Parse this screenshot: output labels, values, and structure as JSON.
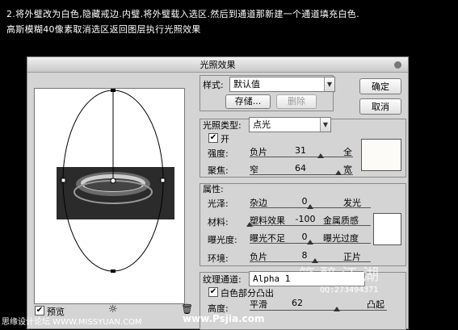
{
  "instruction": {
    "line1": "2.将外璧改为白色,隐藏戒边.内璧.将外璧载入选区.然后到通道那新建一个通道填充白色.",
    "line2": "高斯模糊40像素取消选区返回图层执行光照效果"
  },
  "dialog": {
    "title": "光照效果",
    "style": {
      "label": "样式:",
      "value": "默认值",
      "save_label": "存储...",
      "delete_label": "删除"
    },
    "ok_label": "确定",
    "cancel_label": "取消",
    "light_type": {
      "label": "光照类型:",
      "value": "点光",
      "on_label": "开",
      "on_checked": true,
      "intensity": {
        "label": "强度:",
        "min_label": "负片",
        "value": "31",
        "max_label": "全",
        "fraction": 0.66
      },
      "focus": {
        "label": "聚焦:",
        "min_label": "窄",
        "value": "64",
        "max_label": "宽",
        "fraction": 0.82
      },
      "light_color": "#fdfbf8"
    },
    "properties": {
      "label": "属性:",
      "gloss": {
        "label": "光泽:",
        "min_label": "杂边",
        "value": "0",
        "max_label": "发光",
        "fraction": 0.5
      },
      "material": {
        "label": "材料:",
        "min_label": "塑料效果",
        "value": "-100",
        "max_label": "金属质感",
        "fraction": 0.0
      },
      "exposure": {
        "label": "曝光度:",
        "min_label": "曝光不足",
        "value": "0",
        "max_label": "曝光过度",
        "fraction": 0.5
      },
      "ambience": {
        "label": "环境:",
        "min_label": "负片",
        "value": "8",
        "max_label": "正片",
        "fraction": 0.54
      },
      "ambient_color": "#ffffff"
    },
    "texture": {
      "label": "纹理通道:",
      "value": "Alpha 1",
      "white_high_label": "白色部分凸出",
      "white_high_checked": true,
      "height": {
        "label": "高度:",
        "min_label": "平滑",
        "value": "62",
        "max_label": "凸起",
        "fraction": 0.62
      }
    },
    "preview_label": "预览",
    "preview_checked": true
  },
  "watermarks": {
    "site_left": "思缘设计论坛 WWW.MISSYUAN.COM",
    "site_center": "www.Psjia.com",
    "signature": "笑 醉 江 湖",
    "qq": "QQ:273494371"
  }
}
